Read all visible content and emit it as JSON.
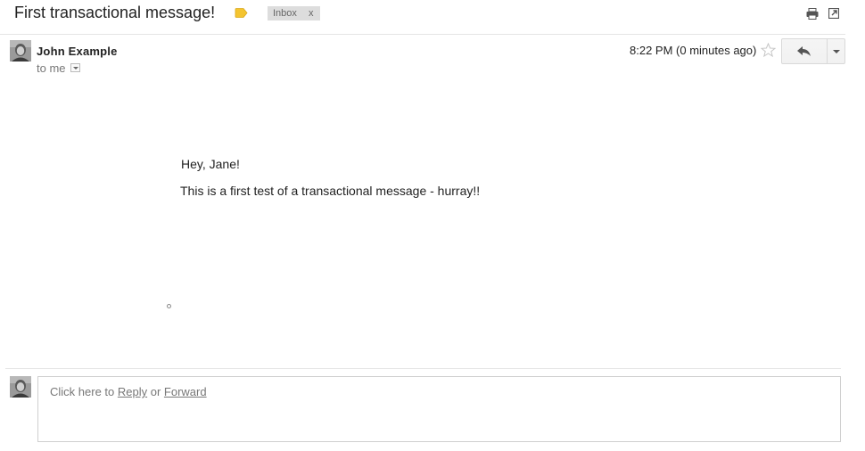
{
  "subject": {
    "title": "First transactional message!",
    "label_icon": "label-tag-icon",
    "label_color": "#f4c430",
    "inbox_chip": {
      "label": "Inbox",
      "remove": "x"
    },
    "actions": {
      "print_icon": "print-icon",
      "popout_icon": "new-window-icon"
    }
  },
  "message": {
    "sender_name": "John Example",
    "recipient": "to me",
    "timestamp": "8:22 PM (0 minutes ago)",
    "star_icon": "star-icon",
    "reply_icon": "reply-arrow-icon",
    "more_icon": "chevron-down-icon"
  },
  "body": {
    "greeting": "Hey, Jane!",
    "text": "This is a first test of a transactional message - hurray!!"
  },
  "reply_box": {
    "prefix": "Click here to ",
    "reply_link": "Reply",
    "middle": " or ",
    "forward_link": "Forward"
  }
}
